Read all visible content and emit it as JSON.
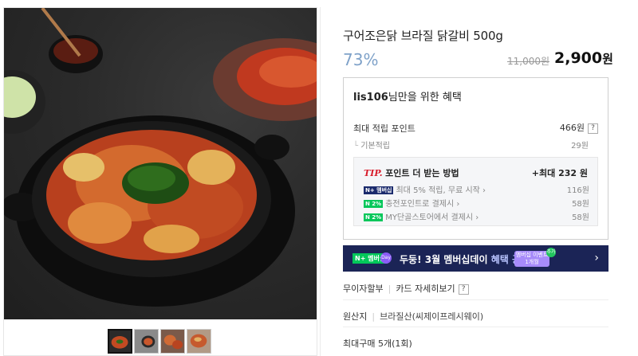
{
  "product": {
    "title": "구어조은닭 브라질 닭갈비 500g",
    "discount": "73%",
    "original_price": "11,000원",
    "price": "2,900",
    "price_unit": "원"
  },
  "benefit": {
    "user": "lis106",
    "heading_suffix": "님만을 위한 혜택",
    "max_points_label": "최대 적립 포인트",
    "max_points_value": "466원",
    "basic_label": "기본적립",
    "basic_value": "29원",
    "tip_label": "TIP.",
    "tip_text": "포인트 더 받는 방법",
    "tip_max": "+최대 232 원",
    "tips": [
      {
        "badge": "N+ 멤버십",
        "text": "최대 5% 적립, 무료 시작 ›",
        "value": "116원"
      },
      {
        "badge": "N 2%",
        "text": "충전포인트로 결제시 ›",
        "value": "58원"
      },
      {
        "badge": "N 2%",
        "text": "MY단골스토어에서 결제시 ›",
        "value": "58원"
      }
    ]
  },
  "banner": {
    "logo": "N+ 멤버십",
    "circle": "Day",
    "text": "두둥! 3월 멤버십데이",
    "highlight": "혜택 공개",
    "mini_line1": "멤버십 이벤트",
    "mini_line2": "1개월",
    "spark": "추가",
    "chevron": "›"
  },
  "details": {
    "installment": "무이자할부",
    "card_info": "카드 자세히보기",
    "qm": "?",
    "origin_label": "원산지",
    "origin_value": "브라질산(씨제이프레시웨이)",
    "max_buy": "최대구매 5개(1회)"
  },
  "colors": {
    "discount": "#7fa2c9",
    "banner_bg": "#1b2456",
    "naver_green": "#03c75a",
    "tip_red": "#d81b2a"
  }
}
